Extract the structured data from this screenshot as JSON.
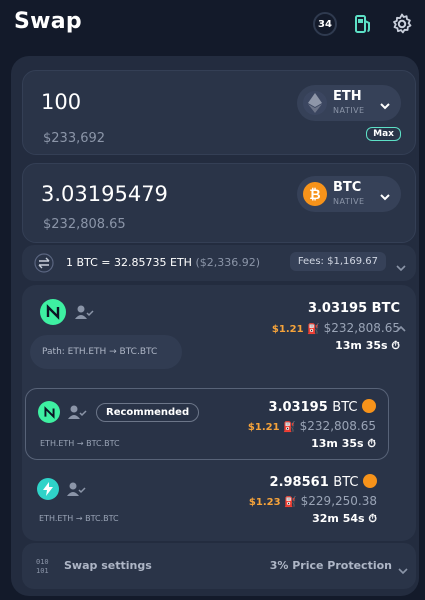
{
  "header": {
    "title": "Swap",
    "notification_count": "34",
    "gas_icon": "fuel-pump-icon",
    "settings_icon": "gear-icon"
  },
  "colors": {
    "accent": "#1f7ef5",
    "background": "#131a2a",
    "card": "#232c3f",
    "btc": "#f7931a",
    "gas": "#f6a33a",
    "teal": "#5de0c6"
  },
  "from": {
    "amount": "100",
    "usd": "$233,692",
    "token": "ETH",
    "chain": "NATIVE",
    "max_label": "Max"
  },
  "to": {
    "amount": "3.03195479",
    "usd": "$232,808.65",
    "token": "BTC",
    "chain": "NATIVE"
  },
  "rate": {
    "text": "1 BTC = 32.85735 ETH",
    "usd": "($2,336.92)",
    "fees": "Fees: $1,169.67"
  },
  "selected_route": {
    "path": "Path: ETH.ETH → BTC.BTC",
    "amount": "3.03195 BTC",
    "gas": "$1.21",
    "usd": "$232,808.65",
    "time": "13m 35s"
  },
  "routes": [
    {
      "recommended": "Recommended",
      "path": "ETH.ETH → BTC.BTC",
      "amount": "3.03195",
      "token": "BTC",
      "gas": "$1.21",
      "usd": "$232,808.65",
      "time": "13m 35s"
    },
    {
      "path": "ETH.ETH → BTC.BTC",
      "amount": "2.98561",
      "token": "BTC",
      "gas": "$1.23",
      "usd": "$229,250.38",
      "time": "32m 54s"
    }
  ],
  "settings": {
    "label": "Swap settings",
    "protection": "3% Price Protection"
  }
}
